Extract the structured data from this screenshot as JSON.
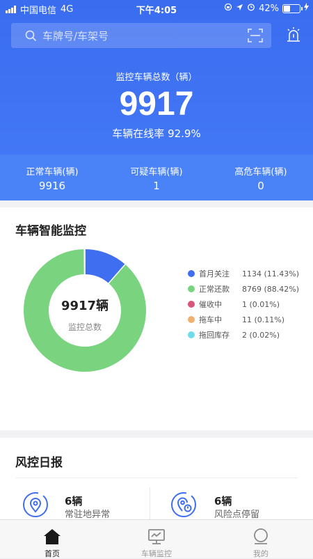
{
  "status": {
    "carrier": "中国电信",
    "network": "4G",
    "time": "下午4:05",
    "battery": "42%",
    "battery_level": 0.42
  },
  "search": {
    "placeholder": "车牌号/车架号"
  },
  "summary": {
    "title": "监控车辆总数（辆）",
    "total": "9917",
    "online_label": "车辆在线率",
    "online_value": "92.9%"
  },
  "stats": [
    {
      "label": "正常车辆(辆)",
      "value": "9916"
    },
    {
      "label": "可疑车辆(辆)",
      "value": "1"
    },
    {
      "label": "高危车辆(辆)",
      "value": "0"
    }
  ],
  "monitor": {
    "title": "车辆智能监控",
    "center_value": "9917辆",
    "center_label": "监控总数",
    "legend": [
      {
        "name": "首月关注",
        "value": "1134 (11.43%)",
        "color": "#3f6ef0"
      },
      {
        "name": "正常还款",
        "value": "8769 (88.42%)",
        "color": "#7ad47f"
      },
      {
        "name": "催收中",
        "value": "1 (0.01%)",
        "color": "#d9557a"
      },
      {
        "name": "拖车中",
        "value": "11 (0.11%)",
        "color": "#f0b070"
      },
      {
        "name": "拖回库存",
        "value": "2 (0.02%)",
        "color": "#6fdcee"
      }
    ]
  },
  "chart_data": {
    "type": "pie",
    "categories": [
      "首月关注",
      "正常还款",
      "催收中",
      "拖车中",
      "拖回库存"
    ],
    "values": [
      1134,
      8769,
      1,
      11,
      2
    ],
    "percentages": [
      11.43,
      88.42,
      0.01,
      0.11,
      0.02
    ],
    "colors": [
      "#3f6ef0",
      "#7ad47f",
      "#d9557a",
      "#f0b070",
      "#6fdcee"
    ]
  },
  "daily": {
    "title": "风控日报",
    "items": [
      {
        "count": "6辆",
        "label": "常驻地异常"
      },
      {
        "count": "6辆",
        "label": "风险点停留"
      }
    ]
  },
  "tabs": [
    {
      "label": "首页",
      "icon": "home-icon"
    },
    {
      "label": "车辆监控",
      "icon": "monitor-icon"
    },
    {
      "label": "我的",
      "icon": "profile-icon"
    }
  ]
}
